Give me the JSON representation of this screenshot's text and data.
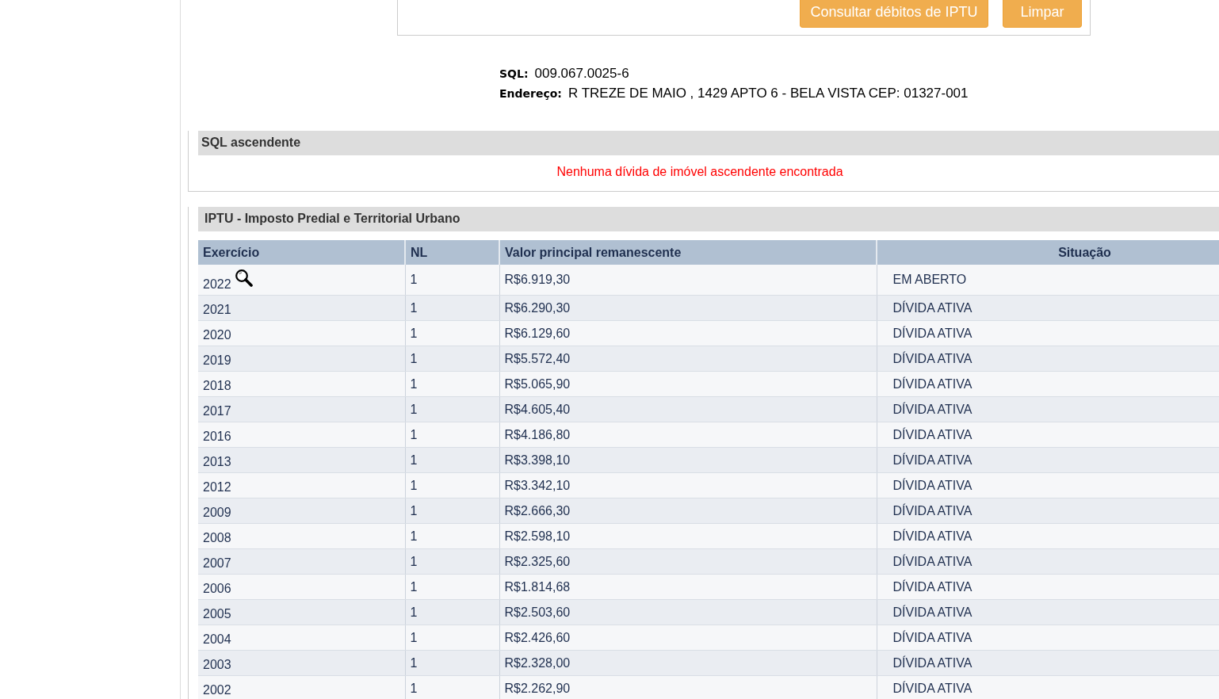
{
  "form": {
    "buttons": [
      "Consultar débitos de IPTU",
      "Limpar"
    ]
  },
  "property": [
    {
      "label": "SQL:",
      "value": "009.067.0025-6"
    },
    {
      "label": "Endereço:",
      "value": "R TREZE DE MAIO , 1429 APTO 6 - BELA VISTA CEP: 01327-001"
    }
  ],
  "ascendente": {
    "title": "SQL ascendente",
    "message": "Nenhuma dívida de imóvel ascendente encontrada"
  },
  "iptu": {
    "title": "IPTU - Imposto Predial e Territorial Urbano",
    "table": {
      "columns": [
        "Exercício",
        "NL",
        "Valor principal remanescente",
        "Situação"
      ],
      "rows": [
        {
          "exercicio": "2022",
          "details": true,
          "nl": "1",
          "valor": "R$6.919,30",
          "situacao": "EM ABERTO"
        },
        {
          "exercicio": "2021",
          "details": false,
          "nl": "1",
          "valor": "R$6.290,30",
          "situacao": "DÍVIDA ATIVA"
        },
        {
          "exercicio": "2020",
          "details": false,
          "nl": "1",
          "valor": "R$6.129,60",
          "situacao": "DÍVIDA ATIVA"
        },
        {
          "exercicio": "2019",
          "details": false,
          "nl": "1",
          "valor": "R$5.572,40",
          "situacao": "DÍVIDA ATIVA"
        },
        {
          "exercicio": "2018",
          "details": false,
          "nl": "1",
          "valor": "R$5.065,90",
          "situacao": "DÍVIDA ATIVA"
        },
        {
          "exercicio": "2017",
          "details": false,
          "nl": "1",
          "valor": "R$4.605,40",
          "situacao": "DÍVIDA ATIVA"
        },
        {
          "exercicio": "2016",
          "details": false,
          "nl": "1",
          "valor": "R$4.186,80",
          "situacao": "DÍVIDA ATIVA"
        },
        {
          "exercicio": "2013",
          "details": false,
          "nl": "1",
          "valor": "R$3.398,10",
          "situacao": "DÍVIDA ATIVA"
        },
        {
          "exercicio": "2012",
          "details": false,
          "nl": "1",
          "valor": "R$3.342,10",
          "situacao": "DÍVIDA ATIVA"
        },
        {
          "exercicio": "2009",
          "details": false,
          "nl": "1",
          "valor": "R$2.666,30",
          "situacao": "DÍVIDA ATIVA"
        },
        {
          "exercicio": "2008",
          "details": false,
          "nl": "1",
          "valor": "R$2.598,10",
          "situacao": "DÍVIDA ATIVA"
        },
        {
          "exercicio": "2007",
          "details": false,
          "nl": "1",
          "valor": "R$2.325,60",
          "situacao": "DÍVIDA ATIVA"
        },
        {
          "exercicio": "2006",
          "details": false,
          "nl": "1",
          "valor": "R$1.814,68",
          "situacao": "DÍVIDA ATIVA"
        },
        {
          "exercicio": "2005",
          "details": false,
          "nl": "1",
          "valor": "R$2.503,60",
          "situacao": "DÍVIDA ATIVA"
        },
        {
          "exercicio": "2004",
          "details": false,
          "nl": "1",
          "valor": "R$2.426,60",
          "situacao": "DÍVIDA ATIVA"
        },
        {
          "exercicio": "2003",
          "details": false,
          "nl": "1",
          "valor": "R$2.328,00",
          "situacao": "DÍVIDA ATIVA"
        },
        {
          "exercicio": "2002",
          "details": false,
          "nl": "1",
          "valor": "R$2.262,90",
          "situacao": "DÍVIDA ATIVA"
        }
      ]
    }
  }
}
